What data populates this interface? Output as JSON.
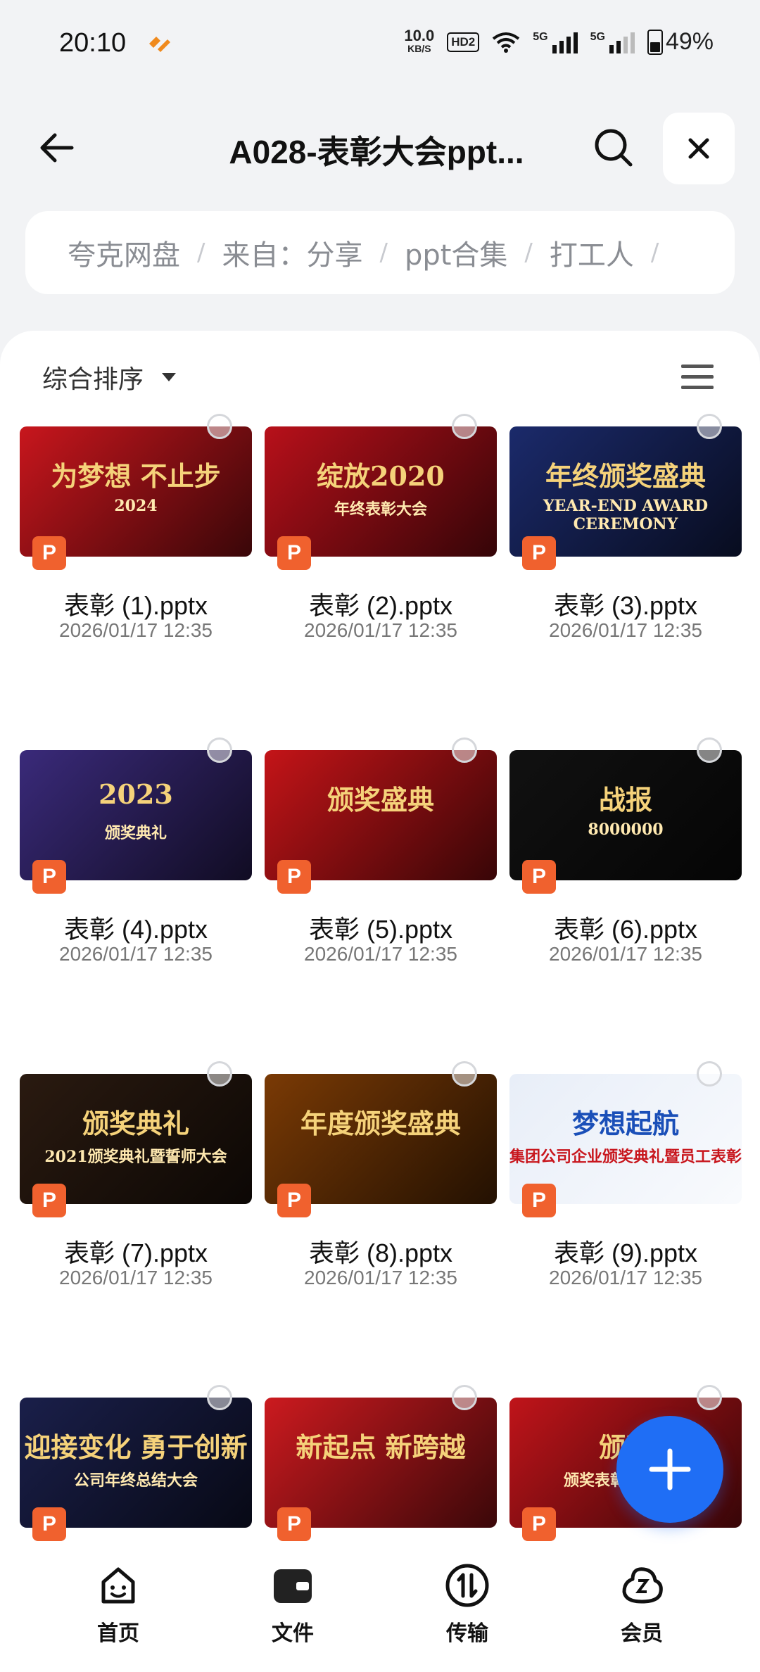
{
  "status": {
    "time": "20:10",
    "speed": "10.0",
    "speed_unit": "KB/S",
    "hd": "HD2",
    "net1": "5G",
    "net2": "5G",
    "battery": "49%"
  },
  "header": {
    "title": "A028-表彰大会ppt..."
  },
  "breadcrumb": [
    "夸克网盘",
    "来自：分享",
    "ppt合集",
    "打工人"
  ],
  "sort": {
    "label": "综合排序"
  },
  "files": [
    {
      "name": "表彰 (1).pptx",
      "date": "2026/01/17 12:35",
      "thumb_text": "为梦想 不止步",
      "thumb_sub": "2024",
      "bg": "#c8161d"
    },
    {
      "name": "表彰 (2).pptx",
      "date": "2026/01/17 12:35",
      "thumb_text": "绽放2020",
      "thumb_sub": "年终表彰大会",
      "bg": "#b8101a"
    },
    {
      "name": "表彰 (3).pptx",
      "date": "2026/01/17 12:35",
      "thumb_text": "年终颁奖盛典",
      "thumb_sub": "YEAR-END AWARD CEREMONY",
      "bg": "#1b2a6b"
    },
    {
      "name": "表彰 (4).pptx",
      "date": "2026/01/17 12:35",
      "thumb_text": "2023",
      "thumb_sub": "颁奖典礼",
      "bg": "#3a2a7a"
    },
    {
      "name": "表彰 (5).pptx",
      "date": "2026/01/17 12:35",
      "thumb_text": "颁奖盛典",
      "thumb_sub": "",
      "bg": "#c41418"
    },
    {
      "name": "表彰 (6).pptx",
      "date": "2026/01/17 12:35",
      "thumb_text": "战报",
      "thumb_sub": "8000000",
      "bg": "#111111"
    },
    {
      "name": "表彰 (7).pptx",
      "date": "2026/01/17 12:35",
      "thumb_text": "颁奖典礼",
      "thumb_sub": "2021颁奖典礼暨誓师大会",
      "bg": "#2a1a10"
    },
    {
      "name": "表彰 (8).pptx",
      "date": "2026/01/17 12:35",
      "thumb_text": "年度颁奖盛典",
      "thumb_sub": "",
      "bg": "#7a3a05"
    },
    {
      "name": "表彰 (9).pptx",
      "date": "2026/01/17 12:35",
      "thumb_text": "梦想起航",
      "thumb_sub": "集团公司企业颁奖典礼暨员工表彰",
      "bg": "#e8eef8"
    },
    {
      "name": "",
      "date": "",
      "thumb_text": "迎接变化 勇于创新",
      "thumb_sub": "公司年终总结大会",
      "bg": "#1a1f4a"
    },
    {
      "name": "",
      "date": "",
      "thumb_text": "新起点 新跨越",
      "thumb_sub": "",
      "bg": "#cc1a1f"
    },
    {
      "name": "",
      "date": "",
      "thumb_text": "颁奖",
      "thumb_sub": "颁奖表彰人物介绍",
      "bg": "#c0141a"
    }
  ],
  "file_badge": "P",
  "nav": [
    {
      "label": "首页",
      "icon": "smile-icon"
    },
    {
      "label": "文件",
      "icon": "wallet-icon"
    },
    {
      "label": "传输",
      "icon": "transfer-icon"
    },
    {
      "label": "会员",
      "icon": "vip-icon"
    }
  ]
}
